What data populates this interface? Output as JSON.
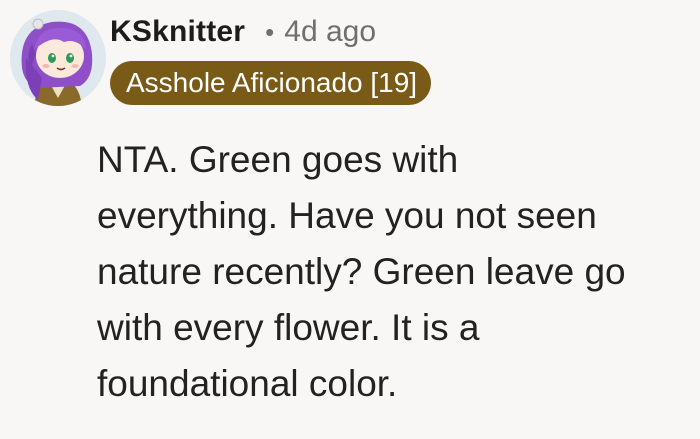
{
  "comment": {
    "username": "KSknitter",
    "separator": "•",
    "timestamp": "4d ago",
    "flair": "Asshole Aficionado [19]",
    "body_lines": [
      "NTA. Green goes with",
      "everything. Have you not seen",
      "nature recently? Green leave go",
      "with every flower. It is a",
      "foundational color."
    ]
  },
  "colors": {
    "background": "#f8f7f5",
    "flair_background": "#7a5a17",
    "flair_text": "#ffffff",
    "meta_text": "#6f6f6f",
    "body_text": "#222222",
    "avatar_hair": "#8e4fc9",
    "avatar_background": "#dfe8ee"
  },
  "icons": {
    "avatar": "user-avatar-icon"
  }
}
